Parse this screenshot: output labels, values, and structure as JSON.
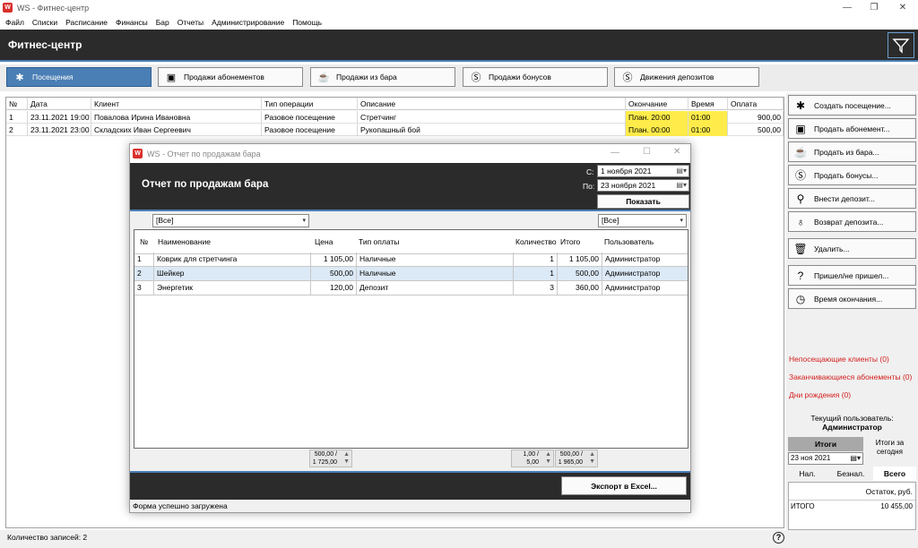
{
  "window": {
    "title": "WS - Фитнес-центр"
  },
  "menu": [
    "Файл",
    "Списки",
    "Расписание",
    "Финансы",
    "Бар",
    "Отчеты",
    "Администрирование",
    "Помощь"
  ],
  "header": {
    "title": "Фитнес-центр"
  },
  "tabs": [
    {
      "label": "Посещения",
      "icon": "visitor-icon"
    },
    {
      "label": "Продажи абонементов",
      "icon": "subscription-icon"
    },
    {
      "label": "Продажи из бара",
      "icon": "cup-icon"
    },
    {
      "label": "Продажи бонусов",
      "icon": "dollar-icon"
    },
    {
      "label": "Движения депозитов",
      "icon": "dollar-icon"
    }
  ],
  "main_table": {
    "columns": [
      "№",
      "Дата",
      "Клиент",
      "Тип операции",
      "Описание",
      "Окончание",
      "Время",
      "Оплата"
    ],
    "rows": [
      [
        "1",
        "23.11.2021 19:00",
        "Повалова Ирина Ивановна",
        "Разовое посещение",
        "Стретчинг",
        "План. 20:00",
        "01:00",
        "900,00"
      ],
      [
        "2",
        "23.11.2021 23:00",
        "Складских Иван Сергеевич",
        "Разовое посещение",
        "Рукопашный бой",
        "План. 00:00",
        "01:00",
        "500,00"
      ]
    ]
  },
  "right_panel": {
    "buttons": [
      {
        "label": "Создать посещение...",
        "icon": "visitor-icon"
      },
      {
        "label": "Продать абонемент...",
        "icon": "subscription-icon"
      },
      {
        "label": "Продать из бара...",
        "icon": "cup-icon"
      },
      {
        "label": "Продать бонусы...",
        "icon": "dollar-icon"
      },
      {
        "label": "Внести депозит...",
        "icon": "deposit-icon"
      },
      {
        "label": "Возврат депозита...",
        "icon": "refund-icon"
      },
      {
        "label": "Удалить...",
        "icon": "trash-icon"
      },
      {
        "label": "Пришел/не пришел...",
        "icon": "question-person-icon"
      },
      {
        "label": "Время окончания...",
        "icon": "clock-icon"
      }
    ],
    "alerts": [
      "Непосещающие клиенты (0)",
      "Заканчивающиеся абонементы (0)",
      "Дни рождения (0)"
    ],
    "current_user_label": "Текущий пользователь:",
    "current_user": "Администратор",
    "totals_tab": "Итоги",
    "totals_today_tab": "Итоги за сегодня",
    "totals_date": "23 ноя  2021",
    "pay_tabs": [
      "Нал.",
      "Безнал.",
      "Всего"
    ],
    "balance_header": "Остаток, руб.",
    "total_label": "ИТОГО",
    "total_value": "10 455,00"
  },
  "status": {
    "records": "Количество записей: 2"
  },
  "dialog": {
    "title": "WS - Отчет по продажам бара",
    "heading": "Отчет по продажам бара",
    "from_label": "С:",
    "from_date": "1  ноября  2021",
    "to_label": "По:",
    "to_date": "23  ноября  2021",
    "show_button": "Показать",
    "filter_left": "[Все]",
    "filter_right": "[Все]",
    "columns": [
      "№",
      "Наименование",
      "Цена",
      "Тип оплаты",
      "Количество",
      "Итого",
      "Пользователь"
    ],
    "rows": [
      [
        "1",
        "Коврик для стретчинга",
        "1 105,00",
        "Наличные",
        "1",
        "1 105,00",
        "Администратор"
      ],
      [
        "2",
        "Шейкер",
        "500,00",
        "Наличные",
        "1",
        "500,00",
        "Администратор"
      ],
      [
        "3",
        "Энергетик",
        "120,00",
        "Депозит",
        "3",
        "360,00",
        "Администратор"
      ]
    ],
    "price_summary": [
      "500,00 /",
      "1 725,00"
    ],
    "qty_summary": [
      "1,00 /",
      "5,00"
    ],
    "total_summary": [
      "500,00 /",
      "1 965,00"
    ],
    "export_button": "Экспорт в Excel...",
    "status": "Форма успешно загружена"
  }
}
